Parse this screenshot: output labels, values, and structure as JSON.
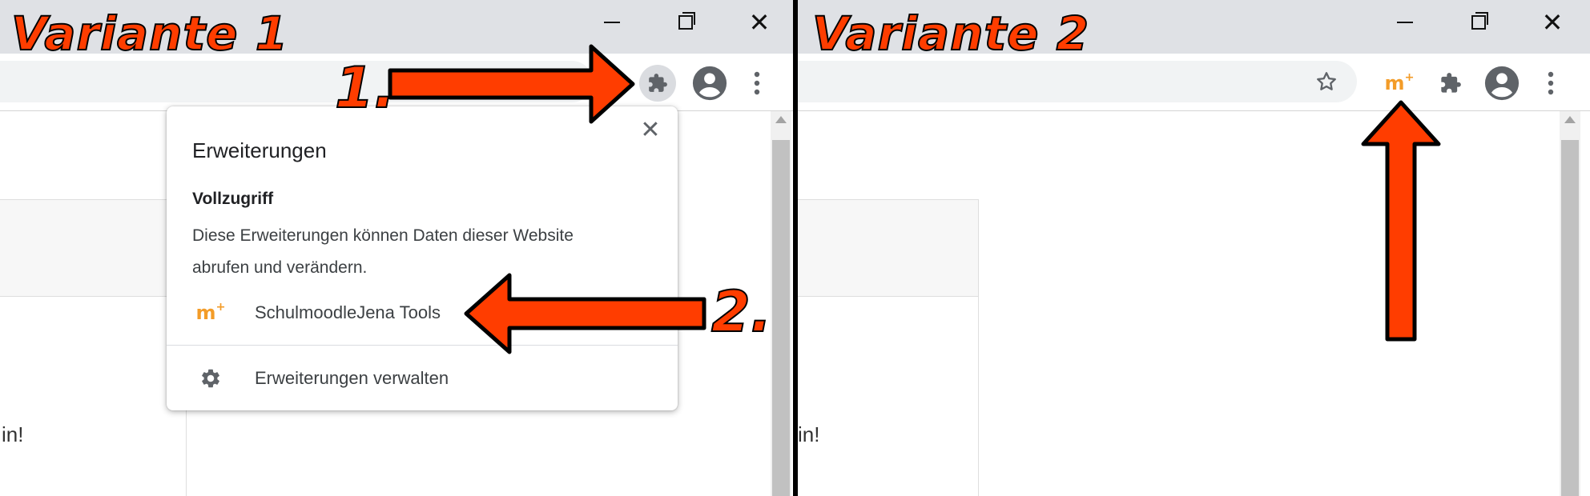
{
  "variant1": {
    "label": "Variante 1",
    "popup": {
      "title": "Erweiterungen",
      "close_icon": "close-icon",
      "section_title": "Vollzugriff",
      "section_desc_line1": "Diese Erweiterungen können Daten dieser Website",
      "section_desc_line2": "abrufen und verändern.",
      "extension_label": "SchulmoodleJena Tools",
      "manage_label": "Erweiterungen verwalten"
    },
    "page_text": "in!",
    "annotation_step1": "1.",
    "annotation_step2": "2."
  },
  "variant2": {
    "label": "Variante 2",
    "page_text": "in!"
  },
  "icons": {
    "extensions": "puzzle-icon",
    "profile": "profile-icon",
    "menu": "kebab-menu-icon",
    "bookmark": "star-icon",
    "extension_app": "moodle-plus-icon",
    "settings": "gear-icon"
  },
  "colors": {
    "annotation": "#ff3d00",
    "titlebar": "#dfe1e5",
    "extension_brand": "#f39c28"
  }
}
